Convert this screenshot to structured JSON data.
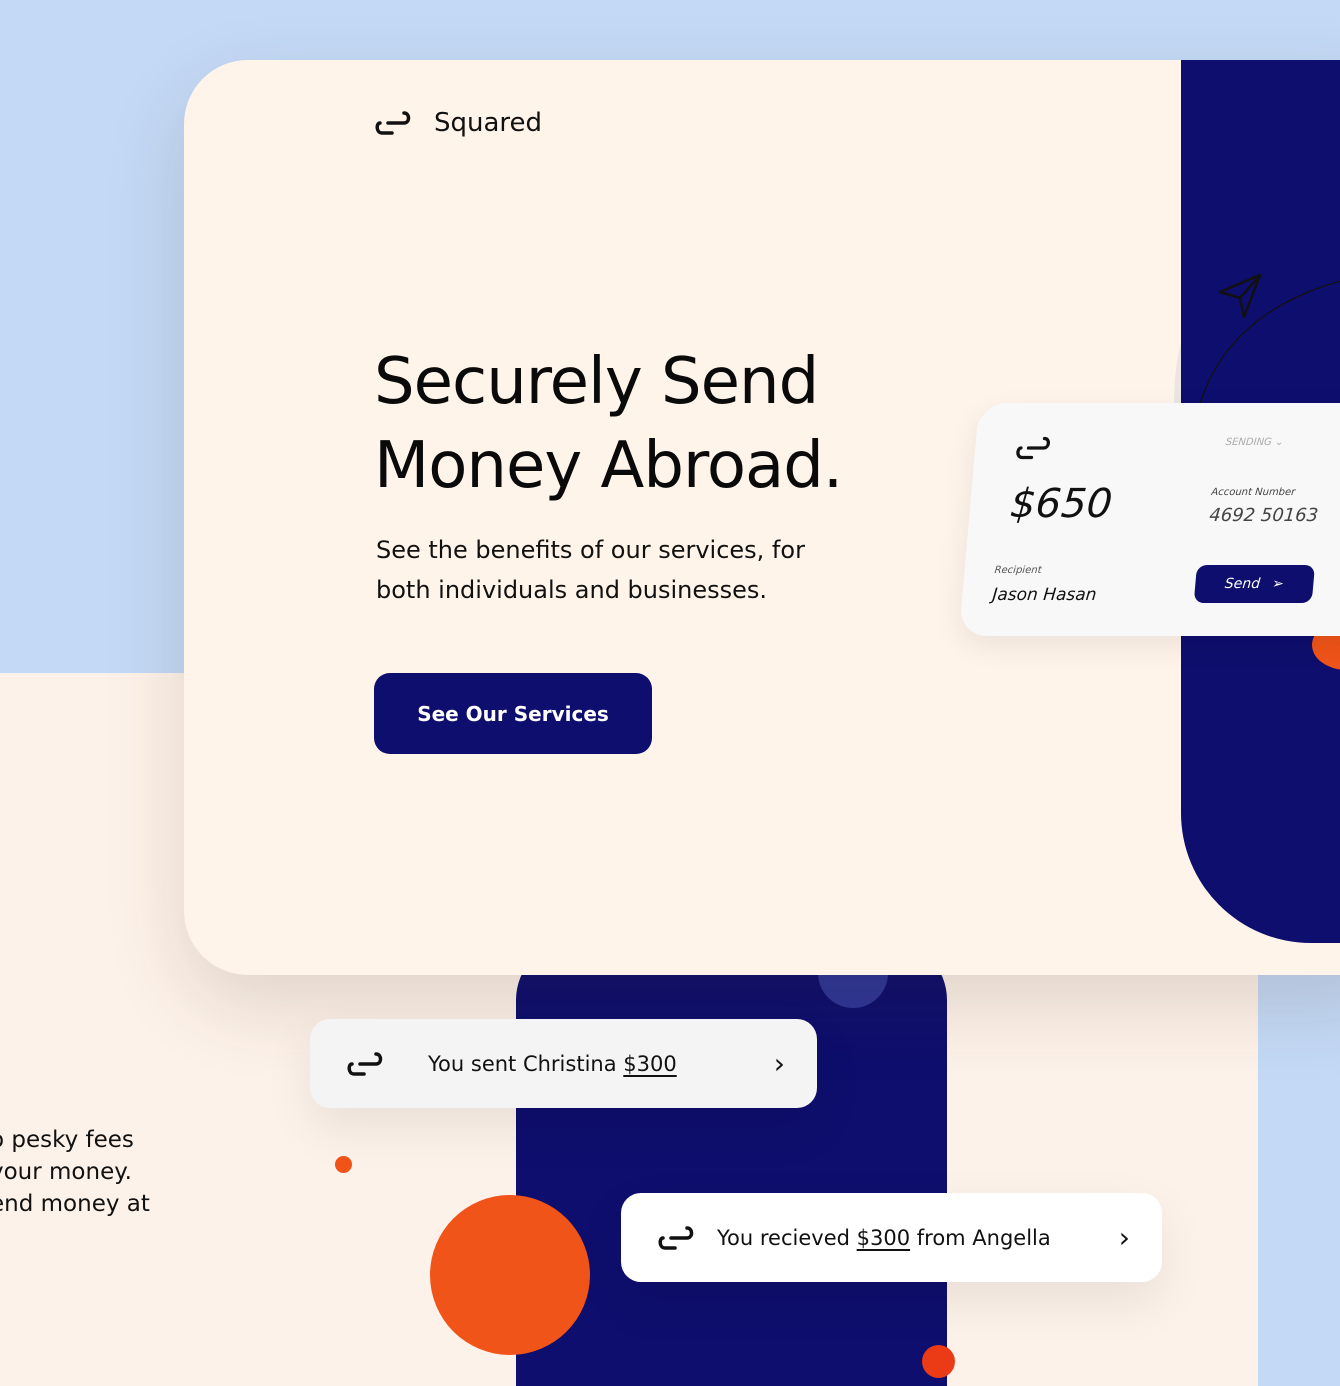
{
  "brand": {
    "name": "Squared"
  },
  "hero": {
    "headline_line1": "Securely Send",
    "headline_line2": "Money Abroad.",
    "subtitle_line1": "See the benefits of our services, for",
    "subtitle_line2": "both individuals and businesses.",
    "cta_label": "See Our Services"
  },
  "widget": {
    "amount": "$650",
    "mode": "SENDING",
    "account_label": "Account Number",
    "account_number": "4692 50163",
    "recipient_label": "Recipient",
    "recipient_name": "Jason Hasan",
    "send_label": "Send"
  },
  "notifications": [
    {
      "prefix": "You sent Christina ",
      "amount": "$300",
      "suffix": ""
    },
    {
      "prefix": "You recieved ",
      "amount": "$300",
      "suffix": " from Angella"
    }
  ],
  "side_text": {
    "line1": "o pesky fees",
    "line2": " your money.",
    "line3": "end money at"
  },
  "colors": {
    "navy": "#0e0e6e",
    "orange": "#f05418",
    "cream": "#fef4ea",
    "sky": "#c4d9f6"
  }
}
